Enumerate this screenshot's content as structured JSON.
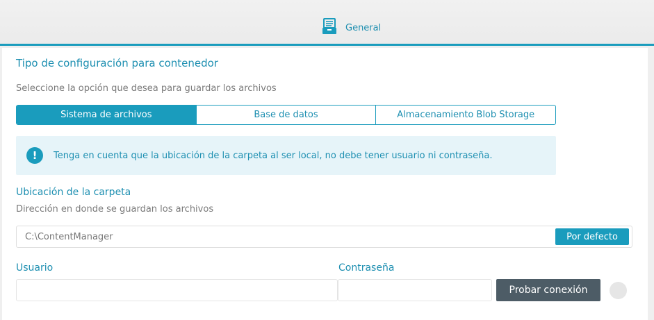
{
  "header": {
    "tab_label": "General",
    "tab_icon": "file-cabinet-icon",
    "accent": "#1a9cbd"
  },
  "section": {
    "title": "Tipo de configuración para contenedor",
    "subtitle": "Seleccione la opción que desea para guardar los archivos",
    "options": [
      {
        "label": "Sistema de archivos",
        "active": true
      },
      {
        "label": "Base de datos",
        "active": false
      },
      {
        "label": "Almacenamiento Blob Storage",
        "active": false
      }
    ]
  },
  "alert": {
    "icon": "exclamation-icon",
    "text": "Tenga en cuenta que la ubicación de la carpeta al ser local, no debe tener usuario ni contraseña."
  },
  "folder": {
    "title": "Ubicación de la carpeta",
    "description": "Dirección en donde se guardan los archivos",
    "path_value": "C:\\ContentManager",
    "default_button": "Por defecto"
  },
  "credentials": {
    "user_label": "Usuario",
    "user_value": "",
    "password_label": "Contraseña",
    "password_value": "",
    "test_button": "Probar conexión",
    "button_color": "#4d5c66"
  }
}
